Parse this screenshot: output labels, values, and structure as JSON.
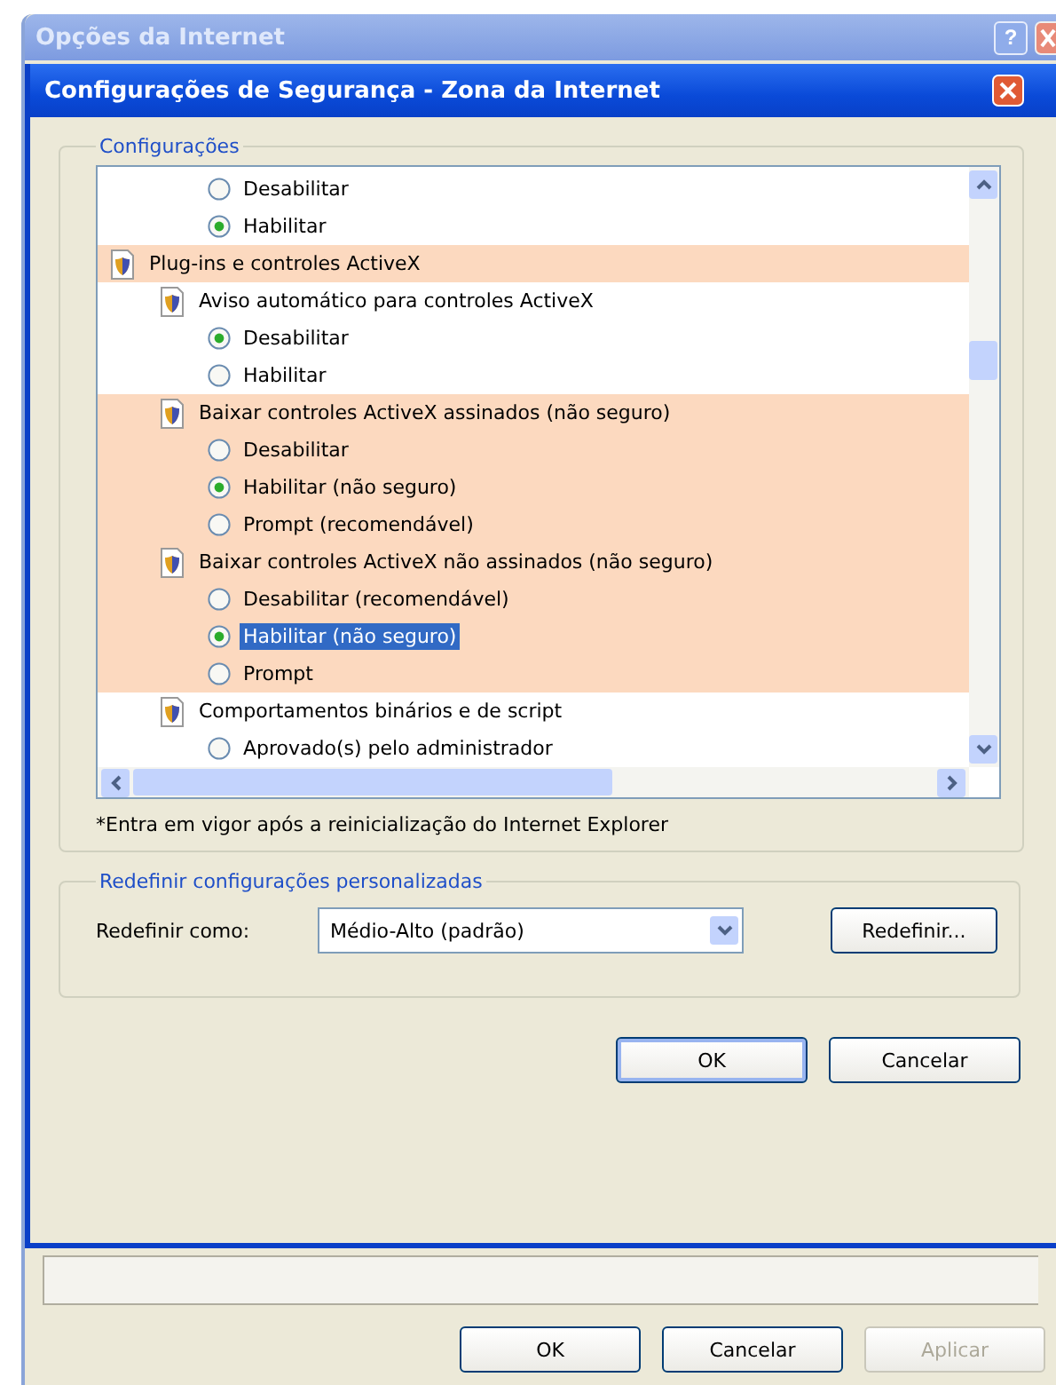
{
  "outer_window": {
    "title": "Opções da Internet",
    "buttons": [
      {
        "kind": "help",
        "label": "?"
      }
    ],
    "footer_buttons": [
      {
        "label": "OK",
        "disabled": false
      },
      {
        "label": "Cancelar",
        "disabled": false
      },
      {
        "label": "Aplicar",
        "disabled": true
      }
    ]
  },
  "dialog": {
    "title": "Configurações de Segurança - Zona da Internet",
    "settings_group": {
      "title": "Configurações",
      "items": [
        {
          "kind": "option",
          "label": "Desabilitar",
          "selected": false,
          "focused": false
        },
        {
          "kind": "option",
          "label": "Habilitar",
          "selected": true,
          "focused": false
        },
        {
          "kind": "category",
          "label": "Plug-ins e controles ActiveX",
          "highlighted": true,
          "children": [
            {
              "kind": "setting",
              "label": "Aviso automático para controles ActiveX",
              "highlighted": false,
              "children": [
                {
                  "kind": "option",
                  "label": "Desabilitar",
                  "selected": true,
                  "focused": false
                },
                {
                  "kind": "option",
                  "label": "Habilitar",
                  "selected": false,
                  "focused": false
                }
              ]
            },
            {
              "kind": "setting",
              "label": "Baixar controles ActiveX assinados (não seguro)",
              "highlighted": true,
              "children": [
                {
                  "kind": "option",
                  "label": "Desabilitar",
                  "selected": false,
                  "focused": false
                },
                {
                  "kind": "option",
                  "label": "Habilitar (não seguro)",
                  "selected": true,
                  "focused": false
                },
                {
                  "kind": "option",
                  "label": "Prompt (recomendável)",
                  "selected": false,
                  "focused": false
                }
              ]
            },
            {
              "kind": "setting",
              "label": "Baixar controles ActiveX não assinados (não seguro)",
              "highlighted": true,
              "children": [
                {
                  "kind": "option",
                  "label": "Desabilitar (recomendável)",
                  "selected": false,
                  "focused": false
                },
                {
                  "kind": "option",
                  "label": "Habilitar (não seguro)",
                  "selected": true,
                  "focused": true
                },
                {
                  "kind": "option",
                  "label": "Prompt",
                  "selected": false,
                  "focused": false
                }
              ]
            },
            {
              "kind": "setting",
              "label": "Comportamentos binários e de script",
              "highlighted": false,
              "children": [
                {
                  "kind": "option",
                  "label": "Aprovado(s) pelo administrador",
                  "selected": false,
                  "focused": false
                }
              ]
            }
          ]
        }
      ],
      "note": "*Entra em vigor após a reinicialização do Internet Explorer"
    },
    "reset_group": {
      "title": "Redefinir configurações personalizadas",
      "label": "Redefinir como:",
      "value": "Médio-Alto (padrão)",
      "button": "Redefinir..."
    },
    "buttons": [
      {
        "label": "OK",
        "default": true
      },
      {
        "label": "Cancelar",
        "default": false
      }
    ]
  }
}
